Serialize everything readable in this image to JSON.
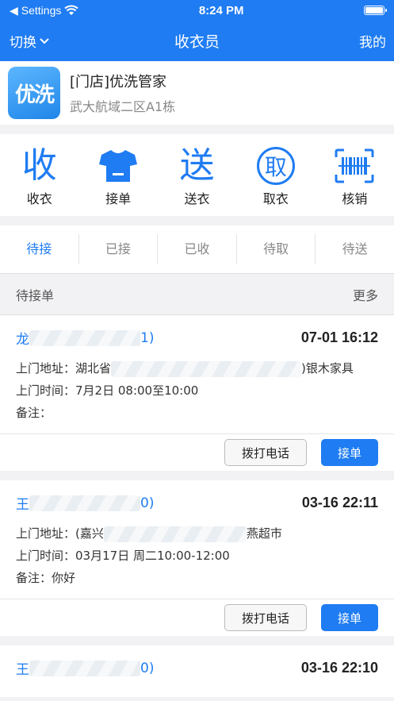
{
  "status": {
    "carrier": "Settings",
    "time": "8:24 PM"
  },
  "nav": {
    "switch_label": "切换",
    "title": "收衣员",
    "mine_label": "我的"
  },
  "store": {
    "logo_text": "优洗",
    "name": "[门店]优洗管家",
    "address": "武大航域二区A1栋"
  },
  "actions": [
    {
      "label": "收衣",
      "glyph": "收",
      "icon": "receive-icon"
    },
    {
      "label": "接单",
      "glyph": "",
      "icon": "tshirt-icon"
    },
    {
      "label": "送衣",
      "glyph": "送",
      "icon": "deliver-icon"
    },
    {
      "label": "取衣",
      "glyph": "取",
      "icon": "pickup-icon"
    },
    {
      "label": "核销",
      "glyph": "",
      "icon": "barcode-scan-icon"
    }
  ],
  "tabs": [
    {
      "label": "待接",
      "active": true
    },
    {
      "label": "已接",
      "active": false
    },
    {
      "label": "已收",
      "active": false
    },
    {
      "label": "待取",
      "active": false
    },
    {
      "label": "待送",
      "active": false
    }
  ],
  "section": {
    "title": "待接单",
    "more": "更多"
  },
  "orders": [
    {
      "name_start": "龙",
      "name_end": "1)",
      "time": "07-01 16:12",
      "address_label": "上门地址：",
      "address_start": "湖北省",
      "address_end": ")银木家具",
      "visit_label": "上门时间：",
      "visit_time": "7月2日 08:00至10:00",
      "note_label": "备注：",
      "note": ""
    },
    {
      "name_start": "王",
      "name_end": "0)",
      "time": "03-16 22:11",
      "address_label": "上门地址：",
      "address_start": "(嘉兴",
      "address_end": "燕超市",
      "visit_label": "上门时间：",
      "visit_time": "03月17日 周二10:00-12:00",
      "note_label": "备注：",
      "note": "你好"
    },
    {
      "name_start": "王",
      "name_end": "0)",
      "time": "03-16 22:10"
    }
  ],
  "buttons": {
    "call": "拨打电话",
    "accept": "接单"
  }
}
